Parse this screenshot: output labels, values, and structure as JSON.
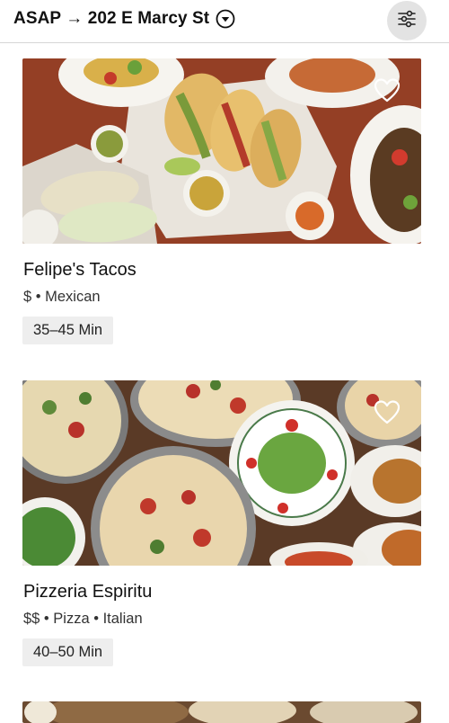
{
  "header": {
    "location": "ASAP → 202 E Marcy St",
    "dropdown_icon": "chevron-down-circle-icon",
    "filter_icon": "sliders-icon"
  },
  "restaurants": [
    {
      "name": "Felipe's Tacos",
      "meta": "$ • Mexican",
      "eta": "35–45 Min",
      "favorite_icon": "heart-outline-icon"
    },
    {
      "name": "Pizzeria Espiritu",
      "meta": "$$ • Pizza • Italian",
      "eta": "40–50 Min",
      "favorite_icon": "heart-outline-icon"
    }
  ]
}
